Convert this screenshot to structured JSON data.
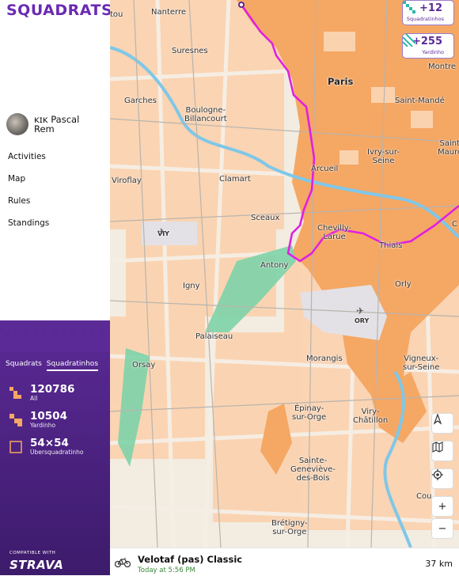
{
  "app": {
    "logo": "SQUADRATS"
  },
  "profile": {
    "name": "ĸɪĸ Pascal Rem"
  },
  "nav": [
    "Activities",
    "Map",
    "Rules",
    "Standings"
  ],
  "panel": {
    "tabs": [
      "Squadrats",
      "Squadratinhos"
    ],
    "active_tab": "Squadratinhos",
    "stats": [
      {
        "value": "120786",
        "label": "All"
      },
      {
        "value": "10504",
        "label": "Yardinho"
      },
      {
        "value": "54×54",
        "label": "Übersquadratinho"
      }
    ],
    "compat_text": "COMPATIBLE WITH",
    "strava_text": "STRAVA"
  },
  "badges": [
    {
      "value": "+12",
      "label": "Squadratinhos"
    },
    {
      "value": "+255",
      "label": "Yardinho"
    }
  ],
  "map_labels": {
    "nanterre": "Nanterre",
    "tou": "tou",
    "suresnes": "Suresnes",
    "paris": "Paris",
    "montre": "Montre",
    "garches": "Garches",
    "boulogne": "Boulogne-\nBillancourt",
    "saint_mande": "Saint-Mandé",
    "ivry": "Ivry-sur-\nSeine",
    "sainte_mau": "Saint\nMaurc",
    "viroflay": "Viroflay",
    "clamart": "Clamart",
    "arcueil": "Arcueil",
    "sceaux": "Sceaux",
    "chevilly": "Chevilly-\nLarue",
    "thiais": "Thiais",
    "c": "C",
    "viy": "VIY",
    "antony": "Antony",
    "igny": "Igny",
    "orly": "Orly",
    "ory": "ORY",
    "palaiseau": "Palaiseau",
    "orsay": "Orsay",
    "morangis": "Morangis",
    "vigneux": "Vigneux-\nsur-Seine",
    "epinay": "Épinay-\nsur-Orge",
    "viry": "Viry-\nChâtillon",
    "sainte_gen": "Sainte-\nGeneviève-\ndes-Bois",
    "cou": "Cou",
    "bretigny": "Brétigny-\nsur-Orge"
  },
  "map_controls": [
    "compass",
    "layers",
    "locate",
    "+",
    "−"
  ],
  "activity": {
    "title": "Velotaf (pas) Classic",
    "time": "Today at 5:56 PM",
    "distance": "37 km"
  },
  "colors": {
    "brand": "#6a2ab3",
    "panel": "#4a2180",
    "route": "#e020e0",
    "squares": "#f5a764",
    "squares_light": "#fbd2ae"
  }
}
